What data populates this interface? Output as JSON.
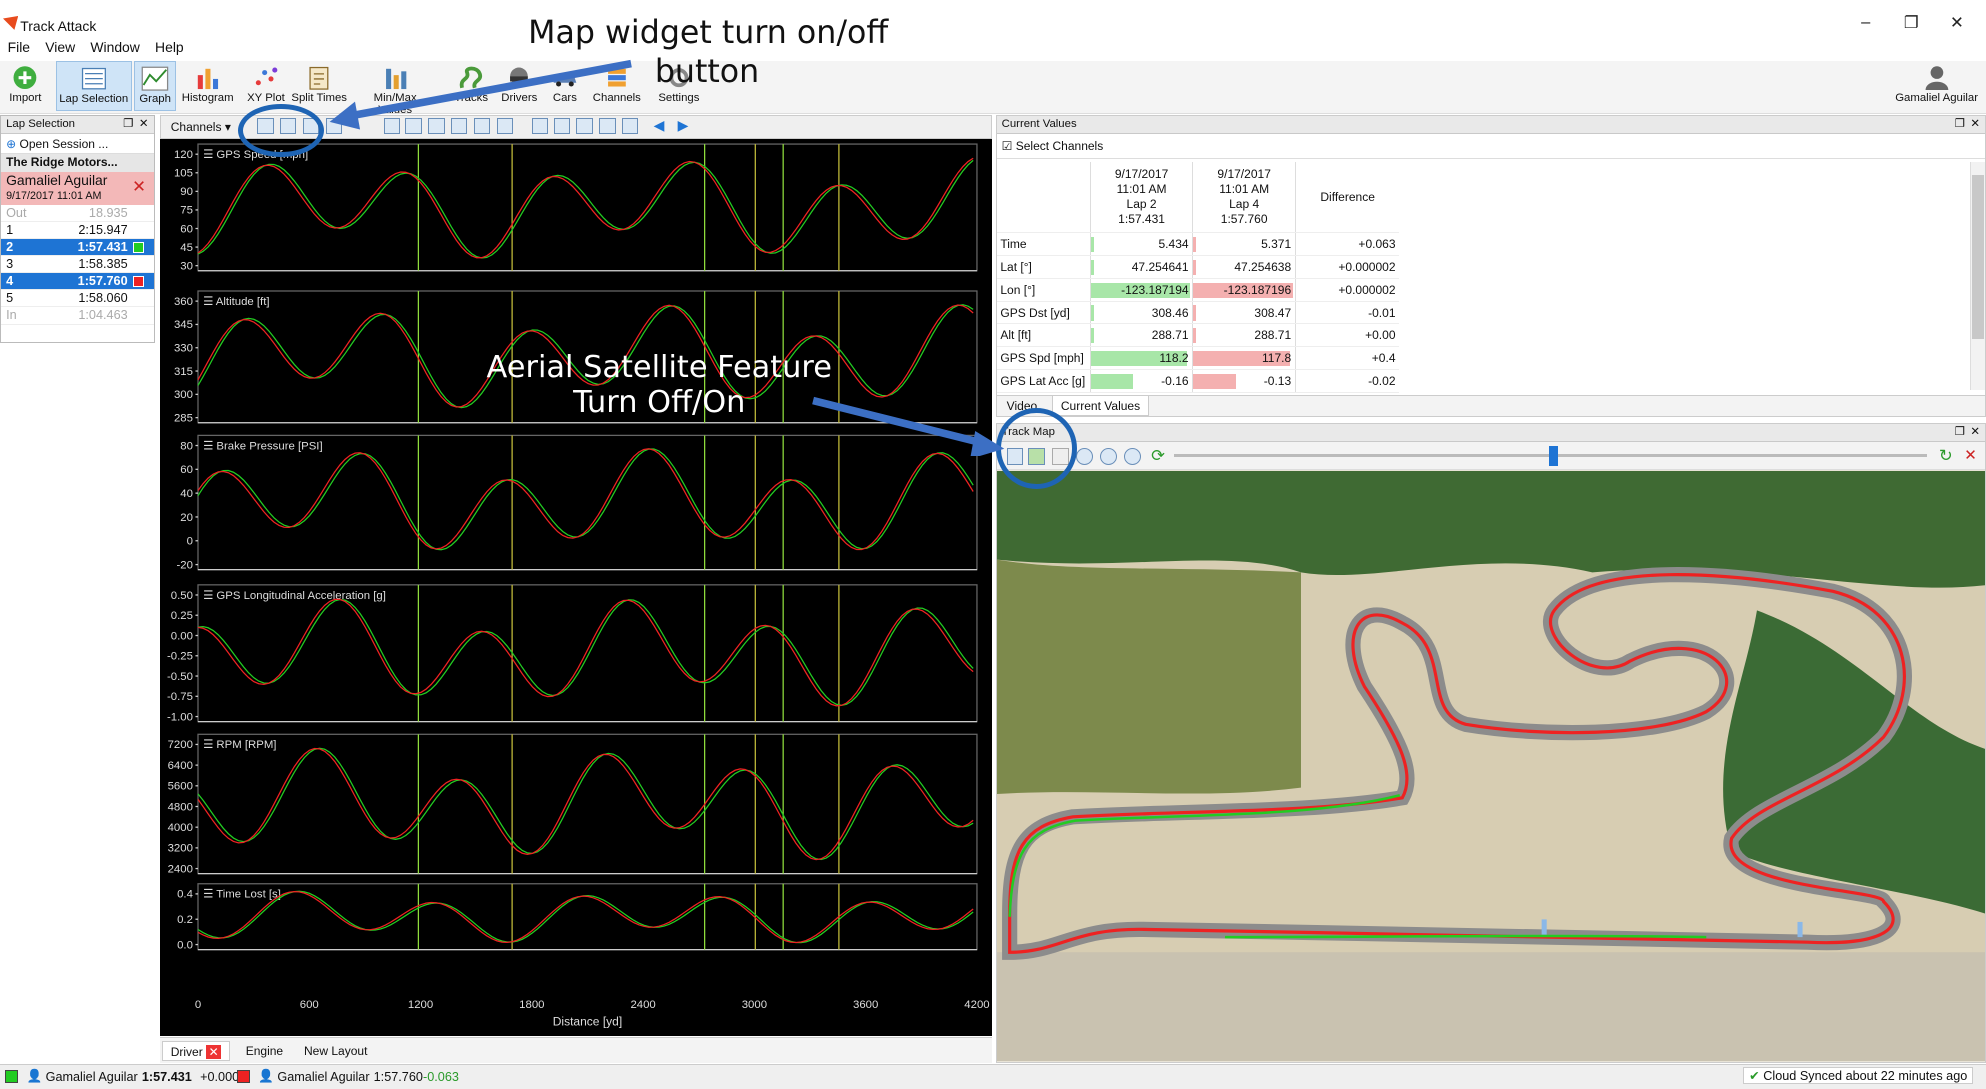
{
  "app": {
    "title": "Track Attack",
    "user": "Gamaliel Aguilar"
  },
  "menu": [
    "File",
    "View",
    "Window",
    "Help"
  ],
  "ribbon": [
    "Import",
    "Lap Selection",
    "Graph",
    "Histogram",
    "XY Plot",
    "Split Times",
    "Min/Max Values",
    "Tracks",
    "Drivers",
    "Cars",
    "Channels",
    "Settings"
  ],
  "lap_selection": {
    "header": "Lap Selection",
    "open_session": "Open Session ...",
    "venue": "The Ridge Motors...",
    "driver": "Gamaliel Aguilar",
    "session_date": "9/17/2017 11:01 AM",
    "laps": [
      {
        "n": "Out",
        "t": "18.935",
        "state": "dim"
      },
      {
        "n": "1",
        "t": "2:15.947",
        "state": "normal"
      },
      {
        "n": "2",
        "t": "1:57.431",
        "state": "selected",
        "color": "#22cc22"
      },
      {
        "n": "3",
        "t": "1:58.385",
        "state": "normal"
      },
      {
        "n": "4",
        "t": "1:57.760",
        "state": "selected",
        "color": "#ee2222"
      },
      {
        "n": "5",
        "t": "1:58.060",
        "state": "normal"
      },
      {
        "n": "In",
        "t": "1:04.463",
        "state": "dim"
      }
    ]
  },
  "graph": {
    "channels_button": "Channels",
    "panels": [
      {
        "title": "GPS Speed [mph]",
        "ticks": [
          "120",
          "105",
          "90",
          "75",
          "60",
          "45",
          "30"
        ]
      },
      {
        "title": "Altitude [ft]",
        "ticks": [
          "360",
          "345",
          "330",
          "315",
          "300",
          "285"
        ]
      },
      {
        "title": "Brake Pressure [PSI]",
        "ticks": [
          "80",
          "60",
          "40",
          "20",
          "0",
          "-20"
        ]
      },
      {
        "title": "GPS Longitudinal Acceleration [g]",
        "ticks": [
          "0.50",
          "0.25",
          "0.00",
          "-0.25",
          "-0.50",
          "-0.75",
          "-1.00"
        ]
      },
      {
        "title": "RPM [RPM]",
        "ticks": [
          "7200",
          "6400",
          "5600",
          "4800",
          "4000",
          "3200",
          "2400"
        ]
      },
      {
        "title": "Time Lost [s]",
        "ticks": [
          "0.4",
          "0.2",
          "0.0"
        ]
      }
    ],
    "x_ticks": [
      "0",
      "600",
      "1200",
      "1800",
      "2400",
      "3000",
      "3600",
      "4200"
    ],
    "x_label": "Distance [yd]",
    "bottom_tabs": [
      "Driver",
      "Engine",
      "New Layout"
    ]
  },
  "current_values": {
    "header": "Current Values",
    "select_channels": "Select Channels",
    "lap_a": [
      "9/17/2017",
      "11:01 AM",
      "Lap 2",
      "1:57.431"
    ],
    "lap_b": [
      "9/17/2017",
      "11:01 AM",
      "Lap 4",
      "1:57.760"
    ],
    "difference_label": "Difference",
    "rows": [
      {
        "name": "Time",
        "a": "5.434",
        "b": "5.371",
        "d": "+0.063",
        "fa": 0.03,
        "fb": 0.03
      },
      {
        "name": "Lat [°]",
        "a": "47.254641",
        "b": "47.254638",
        "d": "+0.000002",
        "fa": 0.03,
        "fb": 0.03
      },
      {
        "name": "Lon [°]",
        "a": "-123.187194",
        "b": "-123.187196",
        "d": "+0.000002",
        "fa": 0.98,
        "fb": 0.98
      },
      {
        "name": "GPS Dst [yd]",
        "a": "308.46",
        "b": "308.47",
        "d": "-0.01",
        "fa": 0.03,
        "fb": 0.03
      },
      {
        "name": "Alt [ft]",
        "a": "288.71",
        "b": "288.71",
        "d": "+0.00",
        "fa": 0.03,
        "fb": 0.03
      },
      {
        "name": "GPS Spd [mph]",
        "a": "118.2",
        "b": "117.8",
        "d": "+0.4",
        "fa": 0.95,
        "fb": 0.95
      },
      {
        "name": "GPS Lat Acc [g]",
        "a": "-0.16",
        "b": "-0.13",
        "d": "-0.02",
        "fa": 0.42,
        "fb": 0.42
      }
    ],
    "tabs": [
      "Video",
      "Current Values"
    ]
  },
  "track_map": {
    "header": "Track Map"
  },
  "annotations": {
    "map_widget": [
      "Map widget turn on/off",
      "button"
    ],
    "aerial": [
      "Aerial Satellite Feature",
      "Turn Off/On"
    ]
  },
  "status": {
    "lap_a": {
      "driver": "Gamaliel Aguilar",
      "time": "1:57.431",
      "delta": "+0.000"
    },
    "lap_b": {
      "driver": "Gamaliel Aguilar",
      "time": "1:57.760",
      "delta": "-0.063"
    },
    "cloud": "Cloud Synced about 22 minutes ago"
  },
  "colors": {
    "lap_a": "#22cc22",
    "lap_b": "#ee2222",
    "accent": "#1e74d4",
    "callout": "#1e64b4"
  }
}
